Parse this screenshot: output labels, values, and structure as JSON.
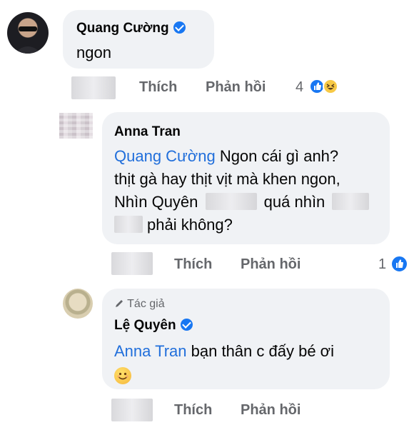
{
  "comments": [
    {
      "author": "Quang Cường",
      "text": "ngon",
      "actions": {
        "like": "Thích",
        "reply": "Phản hồi"
      },
      "reaction_count": "4",
      "reactions": [
        "like-icon",
        "haha-icon"
      ]
    },
    {
      "author": "Anna Tran",
      "mention": "Quang Cường",
      "line1": "Ngon cái gì anh?",
      "line2": "thịt gà hay thịt vịt mà khen ngon,",
      "line3a": "Nhìn Quyên",
      "line3b": "quá nhìn",
      "line4": "phải không?",
      "actions": {
        "like": "Thích",
        "reply": "Phản hồi"
      },
      "reaction_count": "1",
      "reactions": [
        "like-icon"
      ]
    },
    {
      "badge": "Tác giả",
      "author": "Lệ Quyên",
      "mention": "Anna Tran",
      "text": "bạn thân c đấy bé ơi",
      "emoji": "smiling-face-icon",
      "actions": {
        "like": "Thích",
        "reply": "Phản hồi"
      }
    }
  ],
  "colors": {
    "mention": "#216fdb",
    "bubble": "#f0f2f5",
    "verified": "#1877f2",
    "muted": "#65676b"
  }
}
